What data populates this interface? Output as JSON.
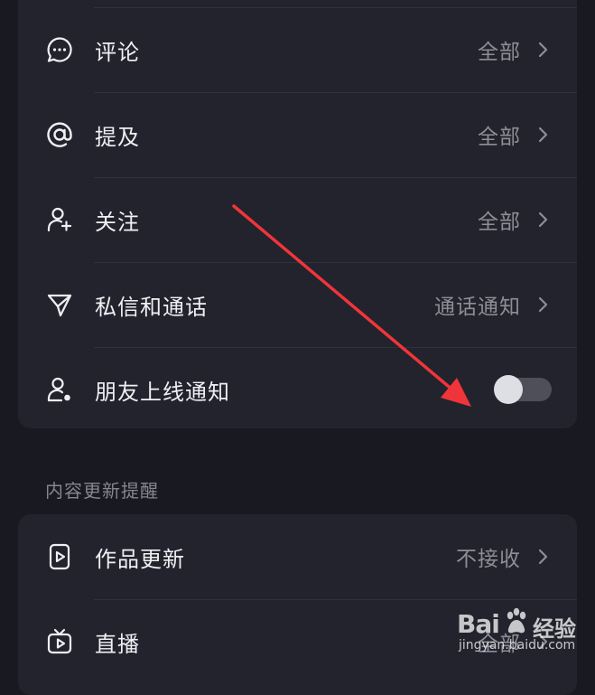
{
  "interaction_section": {
    "items": [
      {
        "label": "评论",
        "value": "全部",
        "icon": "comment-icon"
      },
      {
        "label": "提及",
        "value": "全部",
        "icon": "at-mention-icon"
      },
      {
        "label": "关注",
        "value": "全部",
        "icon": "add-user-icon"
      },
      {
        "label": "私信和通话",
        "value": "通话通知",
        "icon": "send-message-icon"
      },
      {
        "label": "朋友上线通知",
        "toggle_on": false,
        "icon": "user-online-icon"
      }
    ]
  },
  "content_section": {
    "title": "内容更新提醒",
    "items": [
      {
        "label": "作品更新",
        "value": "不接收",
        "icon": "video-play-icon"
      },
      {
        "label": "直播",
        "value": "全部",
        "icon": "live-tv-icon"
      }
    ]
  },
  "watermark": {
    "logo": "Bai",
    "brand": "经验",
    "url": "jingyan.baidu.com"
  },
  "colors": {
    "background": "#181921",
    "card": "#22232c",
    "label_text": "#eff0f4",
    "value_text": "#8d8e96",
    "annotation_arrow": "#f0353a"
  }
}
